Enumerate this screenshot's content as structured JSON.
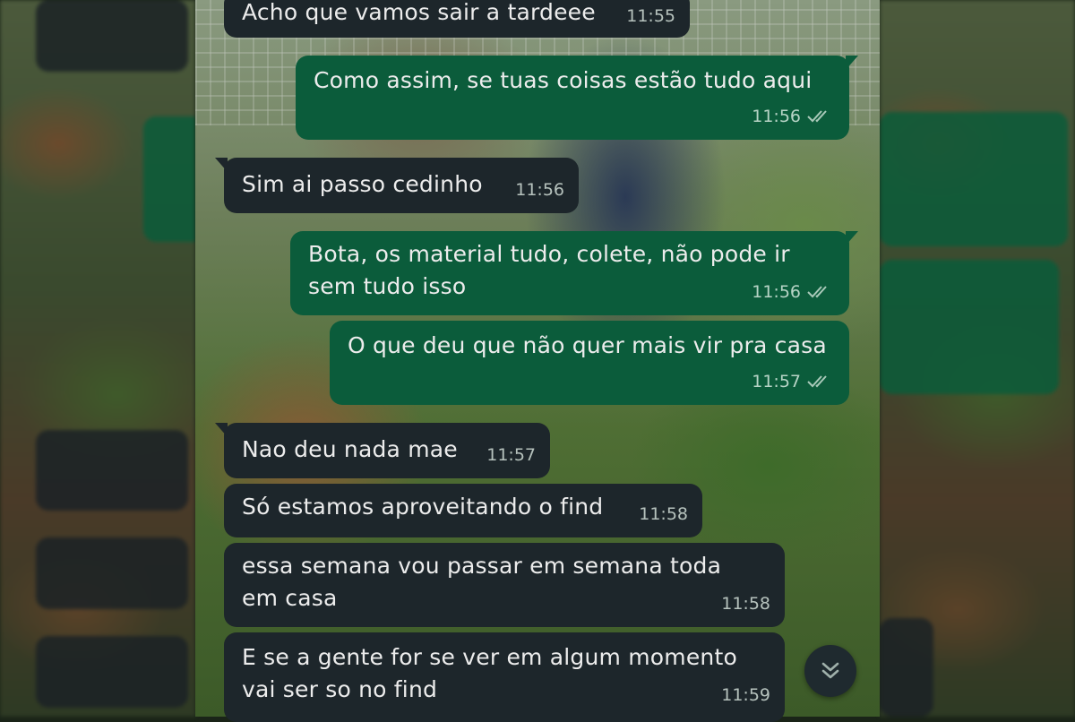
{
  "messages": [
    {
      "dir": "in",
      "text": "Acho que vamos sair a tardeee",
      "time": "11:55",
      "ticks": false
    },
    {
      "dir": "out",
      "text": "Como assim, se tuas coisas estão tudo aqui",
      "time": "11:56",
      "ticks": true
    },
    {
      "dir": "in",
      "text": "Sim ai passo cedinho",
      "time": "11:56",
      "ticks": false
    },
    {
      "dir": "out",
      "text": "Bota, os material tudo, colete, não pode ir\nsem tudo isso",
      "time": "11:56",
      "ticks": true
    },
    {
      "dir": "out",
      "text": "O que deu que não quer mais vir pra casa",
      "time": "11:57",
      "ticks": true
    },
    {
      "dir": "in",
      "text": "Nao deu nada mae",
      "time": "11:57",
      "ticks": false
    },
    {
      "dir": "in",
      "text": "Só estamos aproveitando o find",
      "time": "11:58",
      "ticks": false
    },
    {
      "dir": "in",
      "text": "essa semana vou passar em semana toda\nem casa",
      "time": "11:58",
      "ticks": false
    },
    {
      "dir": "in",
      "text": "E se a gente for se ver em algum momento\nvai ser so no find",
      "time": "11:59",
      "ticks": false
    }
  ],
  "colors": {
    "incoming_bubble": "#1d262b",
    "outgoing_bubble": "#0b5c3b",
    "read_ticks": "#a9c9b9"
  },
  "icons": {
    "read_receipt": "double-check-icon",
    "scroll_down": "double-chevron-down-icon"
  }
}
